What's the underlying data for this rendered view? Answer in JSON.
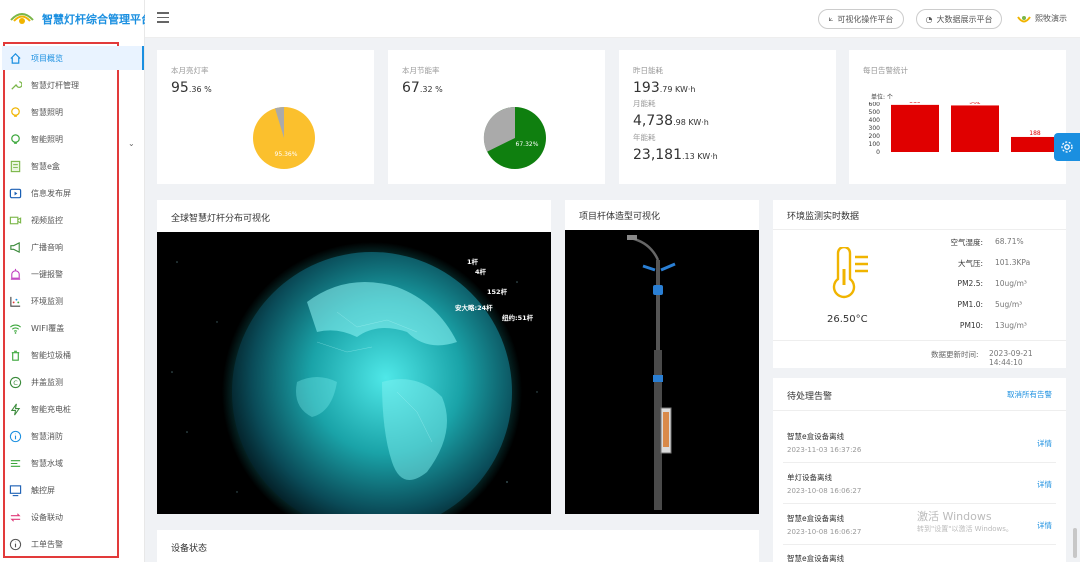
{
  "app": {
    "title": "智慧灯杆综合管理平台"
  },
  "sidebar": {
    "items": [
      {
        "label": "项目概览",
        "icon": "home-icon",
        "active": true
      },
      {
        "label": "智慧灯杆管理",
        "icon": "wrench-icon"
      },
      {
        "label": "智慧照明",
        "icon": "bulb-icon"
      },
      {
        "label": "智能照明",
        "icon": "bulb-green-icon",
        "expandable": true
      },
      {
        "label": "智慧e盒",
        "icon": "ebox-icon"
      },
      {
        "label": "信息发布屏",
        "icon": "screen-play-icon"
      },
      {
        "label": "视频监控",
        "icon": "camera-icon"
      },
      {
        "label": "广播音响",
        "icon": "speaker-icon"
      },
      {
        "label": "一键报警",
        "icon": "alarm-icon"
      },
      {
        "label": "环境监测",
        "icon": "scatter-icon"
      },
      {
        "label": "WIFI覆盖",
        "icon": "wifi-icon"
      },
      {
        "label": "智能垃圾桶",
        "icon": "trash-icon"
      },
      {
        "label": "井盖监测",
        "icon": "manhole-icon"
      },
      {
        "label": "智能充电桩",
        "icon": "lightning-icon"
      },
      {
        "label": "智慧消防",
        "icon": "info-circle-icon"
      },
      {
        "label": "智慧水域",
        "icon": "water-icon"
      },
      {
        "label": "触控屏",
        "icon": "monitor-icon"
      },
      {
        "label": "设备联动",
        "icon": "link-icon"
      },
      {
        "label": "工单告警",
        "icon": "info-circle-icon"
      }
    ]
  },
  "topbar": {
    "visual_button": "可视化操作平台",
    "bigdata_button": "大数据展示平台",
    "user_name": "熙牧演示"
  },
  "stats": {
    "light_rate_label": "本月亮灯率",
    "light_rate_value": "95",
    "light_rate_decimal": ".36 %",
    "light_rate_pie": "95.36%",
    "saving_rate_label": "本月节能率",
    "saving_rate_value": "67",
    "saving_rate_decimal": ".32 %",
    "saving_rate_pie": "67.32%",
    "yesterday_label": "昨日能耗",
    "yesterday_value": "193",
    "yesterday_decimal": ".79 KW·h",
    "month_label": "月能耗",
    "month_value": "4,738",
    "month_decimal": ".98 KW·h",
    "year_label": "年能耗",
    "year_value": "23,181",
    "year_decimal": ".13 KW·h"
  },
  "alarm_stats": {
    "title": "每日告警统计",
    "unit": "单位: 个"
  },
  "chart_data": {
    "type": "bar",
    "title": "每日告警统计",
    "categories": [
      "",
      "",
      ""
    ],
    "values": [
      589,
      582,
      188
    ],
    "ylim": [
      0,
      600
    ],
    "yticks": [
      "600",
      "500",
      "400",
      "300",
      "200",
      "100",
      "0"
    ],
    "color": "#e00000"
  },
  "globe": {
    "title": "全球智慧灯杆分布可视化",
    "labels": [
      "1杆",
      "4杆",
      "152杆",
      "安大略:24杆",
      "纽约:51杆"
    ]
  },
  "pole": {
    "title": "项目杆体造型可视化"
  },
  "env": {
    "title": "环境监测实时数据",
    "temperature": "26.50°C",
    "humidity_label": "空气湿度:",
    "humidity_value": "68.71%",
    "pressure_label": "大气压:",
    "pressure_value": "101.3KPa",
    "pm25_label": "PM2.5:",
    "pm25_value": "10ug/m³",
    "pm1_label": "PM1.0:",
    "pm1_value": "5ug/m³",
    "pm10_label": "PM10:",
    "pm10_value": "13ug/m³",
    "update_label": "数据更新时间:",
    "update_value": "2023-09-21 14:44:10"
  },
  "alarms": {
    "title": "待处理告警",
    "cancel_all": "取消所有告警",
    "detail_label": "详情",
    "items": [
      {
        "title": "智慧e盒设备离线",
        "time": "2023-11-03 16:37:26"
      },
      {
        "title": "单灯设备离线",
        "time": "2023-10-08 16:06:27"
      },
      {
        "title": "智慧e盒设备离线",
        "time": "2023-10-08 16:06:27"
      },
      {
        "title": "智慧e盒设备离线",
        "time": ""
      }
    ]
  },
  "device_status": {
    "title": "设备状态"
  },
  "watermark": {
    "line1": "激活 Windows",
    "line2": "转到\"设置\"以激活 Windows。"
  }
}
